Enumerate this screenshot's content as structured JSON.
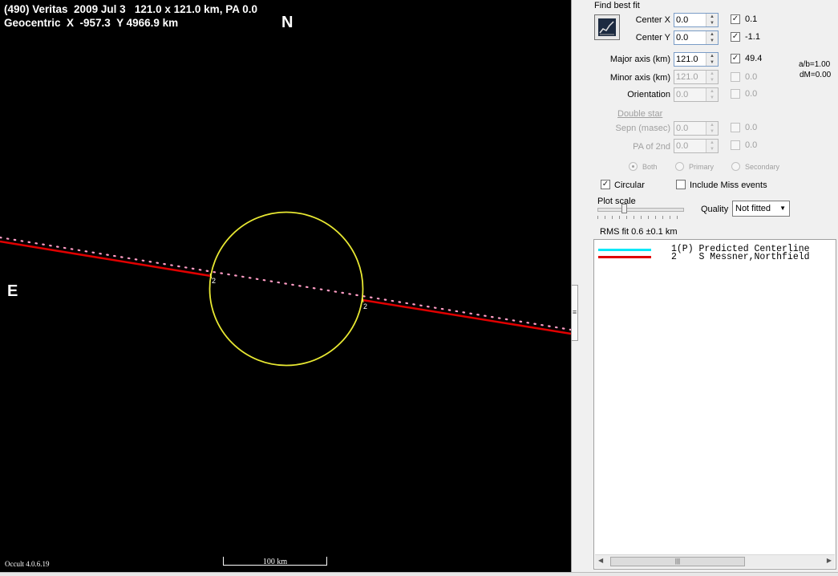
{
  "plot": {
    "title_line1": "(490) Veritas  2009 Jul 3   121.0 x 121.0 km, PA 0.0",
    "title_line2": "Geocentric  X  -957.3  Y 4966.9 km",
    "north": "N",
    "east": "E",
    "version": "Occult 4.0.6.19",
    "scale_label": "100 km",
    "chord_label_1": "2",
    "chord_label_2": "2",
    "colors": {
      "background": "#000000",
      "ellipse": "#e8e832",
      "chord": "#e00000",
      "predicted_dots": "#ff9cc4",
      "centerline": "#00e8f8"
    }
  },
  "panel": {
    "find_best_fit": "Find best fit",
    "center_x_label": "Center X",
    "center_x_value": "0.0",
    "center_x_fit": "0.1",
    "center_y_label": "Center Y",
    "center_y_value": "0.0",
    "center_y_fit": "-1.1",
    "major_label": "Major axis (km)",
    "major_value": "121.0",
    "major_fit": "49.4",
    "minor_label": "Minor axis (km)",
    "minor_value": "121.0",
    "minor_fit": "0.0",
    "orientation_label": "Orientation",
    "orientation_value": "0.0",
    "orientation_fit": "0.0",
    "ab_ratio": "a/b=1.00",
    "dm": "dM=0.00",
    "double_star_label": "Double star",
    "sepn_label": "Sepn (masec)",
    "sepn_value": "0.0",
    "sepn_fit": "0.0",
    "pa2_label": "PA of 2nd",
    "pa2_value": "0.0",
    "pa2_fit": "0.0",
    "radio_both": "Both",
    "radio_primary": "Primary",
    "radio_secondary": "Secondary",
    "circular_label": "Circular",
    "include_miss_label": "Include Miss events",
    "plot_scale_label": "Plot scale",
    "quality_label": "Quality",
    "quality_value": "Not fitted",
    "rms_fit": "RMS fit 0.6 ±0.1 km"
  },
  "legend": {
    "rows": [
      {
        "text": "1(P) Predicted Centerline",
        "color": "#00e8f8"
      },
      {
        "text": "2    S Messner,Northfield",
        "color": "#e00000"
      }
    ]
  }
}
